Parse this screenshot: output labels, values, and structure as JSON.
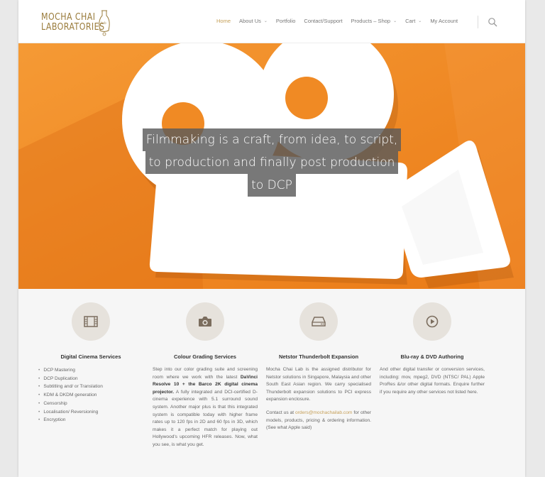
{
  "logo": {
    "line1": "MOCHA CHAI",
    "line2": "LABORATORIES"
  },
  "nav": [
    {
      "label": "Home",
      "active": true,
      "dropdown": false
    },
    {
      "label": "About Us",
      "active": false,
      "dropdown": true
    },
    {
      "label": "Portfolio",
      "active": false,
      "dropdown": false
    },
    {
      "label": "Contact/Support",
      "active": false,
      "dropdown": false
    },
    {
      "label": "Products – Shop",
      "active": false,
      "dropdown": true
    },
    {
      "label": "Cart",
      "active": false,
      "dropdown": true
    },
    {
      "label": "My Account",
      "active": false,
      "dropdown": false
    }
  ],
  "hero": {
    "line1": "Filmmaking is a craft, from idea, to script,",
    "line2": "to production and finally post production",
    "line3": "to DCP"
  },
  "services": {
    "digital_cinema": {
      "icon": "film-icon",
      "title": "Digital Cinema Services",
      "items": [
        "DCP Mastering",
        "DCP Duplication",
        "Subtitling and/ or Translation",
        "KDM & DKDM generation",
        "Censorship",
        "Localisation/ Reversioning",
        "Encryption"
      ]
    },
    "colour_grading": {
      "icon": "camera-icon",
      "title": "Colour Grading Services",
      "p1": "Step into our color grading suite and screening room where we work with the latest ",
      "bold": "DaVinci Resolve 10 + the Barco 2K digital cinema projector.",
      "p2": " A fully integrated and DCI-certified D-cinema experience with 5.1 surround sound system. Another major plus is that this integrated system is compatible today with higher frame rates up to 120 fps in 2D and 60 fps in 3D, which makes it a perfect match for playing out Hollywood's upcoming HFR releases. Now, what you see, is what you get."
    },
    "thunderbolt": {
      "icon": "drive-icon",
      "title": "Netstor Thunderbolt Expansion",
      "p1": "Mocha Chai Lab is the assigned distributor for Netstor solutions in Singapore, Malaysia and other South East Asian region. We carry specialised Thunderbolt expansion solutions to PCI express expansion enclosure.",
      "p2a": "Contact us at ",
      "email": "orders@mochachailab.com",
      "p2b": " for other models, products, pricing & ordering information. (See what Apple said)"
    },
    "bluray": {
      "icon": "play-icon",
      "title": "Blu-ray & DVD Authoring",
      "p1": "And other digital transfer or conversion services, including: mov, mpeg2, DVD (NTSC/ PAL) Apple ProRes &/or other digital formats. Enquire further if you require any other services not listed here."
    }
  },
  "colors": {
    "accent": "#c59f57",
    "hero": "#f08a24",
    "logo": "#9a7c3c"
  }
}
